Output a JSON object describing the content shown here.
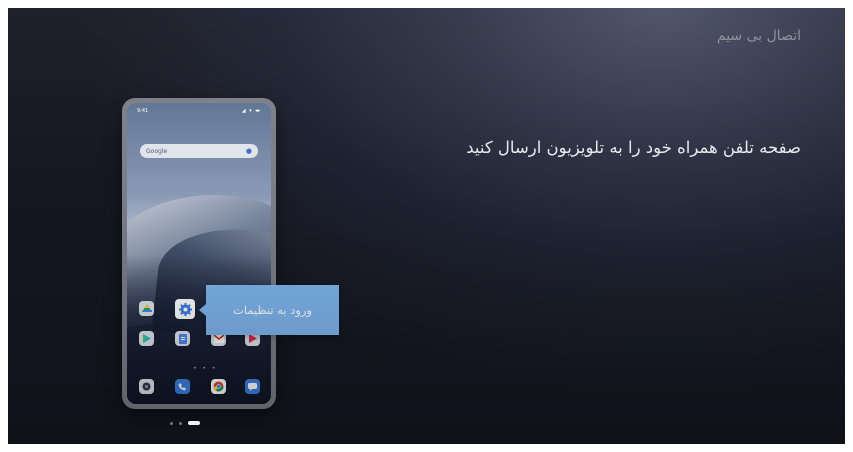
{
  "header": {
    "title": "اتصال بی سیم"
  },
  "main": {
    "instruction": "صفحه تلفن همراه خود را به تلویزیون ارسال کنید"
  },
  "phone": {
    "status_time": "9:41",
    "status_icons": "◢ ▾ ▬",
    "search_bar": {
      "label": "Google",
      "icon": "mic-icon"
    },
    "app_rows": [
      [
        "drive-icon",
        "settings-icon",
        "blank-icon",
        "blank-icon"
      ],
      [
        "play-store-icon",
        "docs-icon",
        "gmail-icon",
        "play-movies-icon"
      ],
      [
        "camera-icon",
        "phone-icon",
        "chrome-icon",
        "messages-icon"
      ]
    ],
    "page_dots": "• • •"
  },
  "tooltip": {
    "label": "ورود به تنظیمات"
  },
  "pager": {
    "count": 3,
    "active_index": 2
  },
  "colors": {
    "tooltip": "#7fb6ee",
    "background": "#1e2230",
    "settings_icon": "#3b7ee0"
  }
}
